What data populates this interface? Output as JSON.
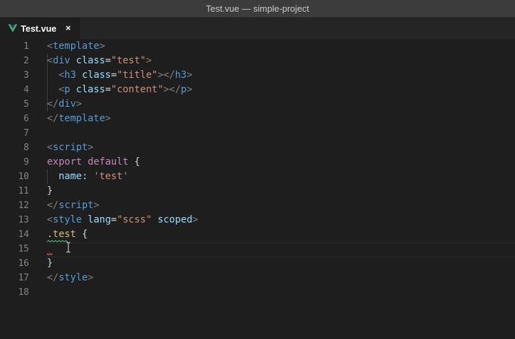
{
  "window": {
    "title": "Test.vue — simple-project"
  },
  "tab": {
    "label": "Test.vue",
    "close_symbol": "×",
    "icon": "vue-logo-icon"
  },
  "colors": {
    "vue_green": "#41b883",
    "vue_dark": "#35495e",
    "error_red": "#f14c4c"
  },
  "editor": {
    "line_numbers": [
      "1",
      "2",
      "3",
      "4",
      "5",
      "6",
      "7",
      "8",
      "9",
      "10",
      "11",
      "12",
      "13",
      "14",
      "15",
      "16",
      "17",
      "18"
    ],
    "code": {
      "l1": {
        "p1": "<",
        "t1": "template",
        "p2": ">"
      },
      "l2": {
        "p1": "<",
        "t1": "div",
        "a1": "class",
        "p2": "=",
        "s1": "\"test\"",
        "p3": ">"
      },
      "l3": {
        "p1": "<",
        "t1": "h3",
        "a1": "class",
        "p2": "=",
        "s1": "\"title\"",
        "p3": "></",
        "t2": "h3",
        "p4": ">"
      },
      "l4": {
        "p1": "<",
        "t1": "p",
        "a1": "class",
        "p2": "=",
        "s1": "\"content\"",
        "p3": "></",
        "t2": "p",
        "p4": ">"
      },
      "l5": {
        "p1": "</",
        "t1": "div",
        "p2": ">"
      },
      "l6": {
        "p1": "</",
        "t1": "template",
        "p2": ">"
      },
      "l8": {
        "p1": "<",
        "t1": "script",
        "p2": ">"
      },
      "l9": {
        "k1": "export",
        "k2": "default",
        "w1": "{"
      },
      "l10": {
        "a1": "name",
        "w1": ":",
        "s1": "'test'"
      },
      "l11": {
        "w1": "}"
      },
      "l12": {
        "p1": "</",
        "t1": "script",
        "p2": ">"
      },
      "l13": {
        "p1": "<",
        "t1": "style",
        "a1": "lang",
        "p2": "=",
        "s1": "\"scss\"",
        "a2": "scoped",
        "p3": ">"
      },
      "l14": {
        "sel1": ".test",
        "w1": "{"
      },
      "l16": {
        "w1": "}"
      },
      "l17": {
        "p1": "</",
        "t1": "style",
        "p2": ">"
      }
    }
  }
}
